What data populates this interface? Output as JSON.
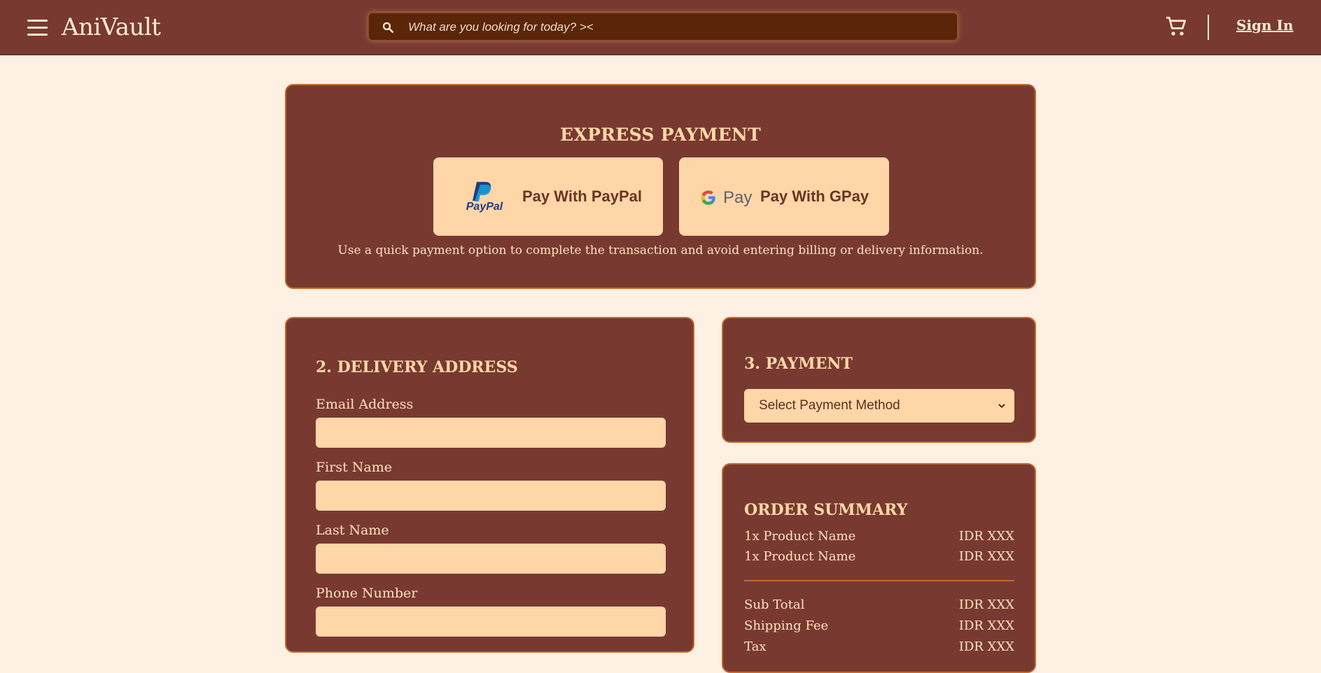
{
  "header": {
    "brand": "AniVault",
    "search_placeholder": "What are you looking for today? ><",
    "sign_in": "Sign In"
  },
  "express": {
    "title": "EXPRESS PAYMENT",
    "paypal_label": "Pay With PayPal",
    "gpay_label": "Pay With GPay",
    "note": "Use a quick payment option to complete the transaction and avoid entering billing or delivery information."
  },
  "delivery": {
    "title": "2. DELIVERY ADDRESS",
    "fields": [
      {
        "label": "Email Address",
        "value": ""
      },
      {
        "label": "First Name",
        "value": ""
      },
      {
        "label": "Last Name",
        "value": ""
      },
      {
        "label": "Phone Number",
        "value": ""
      }
    ]
  },
  "payment": {
    "title": "3. PAYMENT",
    "selected": "Select Payment Method"
  },
  "summary": {
    "title": "ORDER SUMMARY",
    "items": [
      {
        "name": "1x Product Name",
        "price": "IDR XXX"
      },
      {
        "name": "1x Product Name",
        "price": "IDR XXX"
      }
    ],
    "totals": [
      {
        "label": "Sub Total",
        "value": "IDR XXX"
      },
      {
        "label": "Shipping Fee",
        "value": "IDR XXX"
      },
      {
        "label": "Tax",
        "value": "IDR XXX"
      }
    ]
  },
  "colors": {
    "header_bg": "#783a30",
    "page_bg": "#fff0e4",
    "panel_bg": "#783a30",
    "panel_border": "#c26a2a",
    "input_bg": "#ffd6a8",
    "search_bg": "#5a2508"
  }
}
